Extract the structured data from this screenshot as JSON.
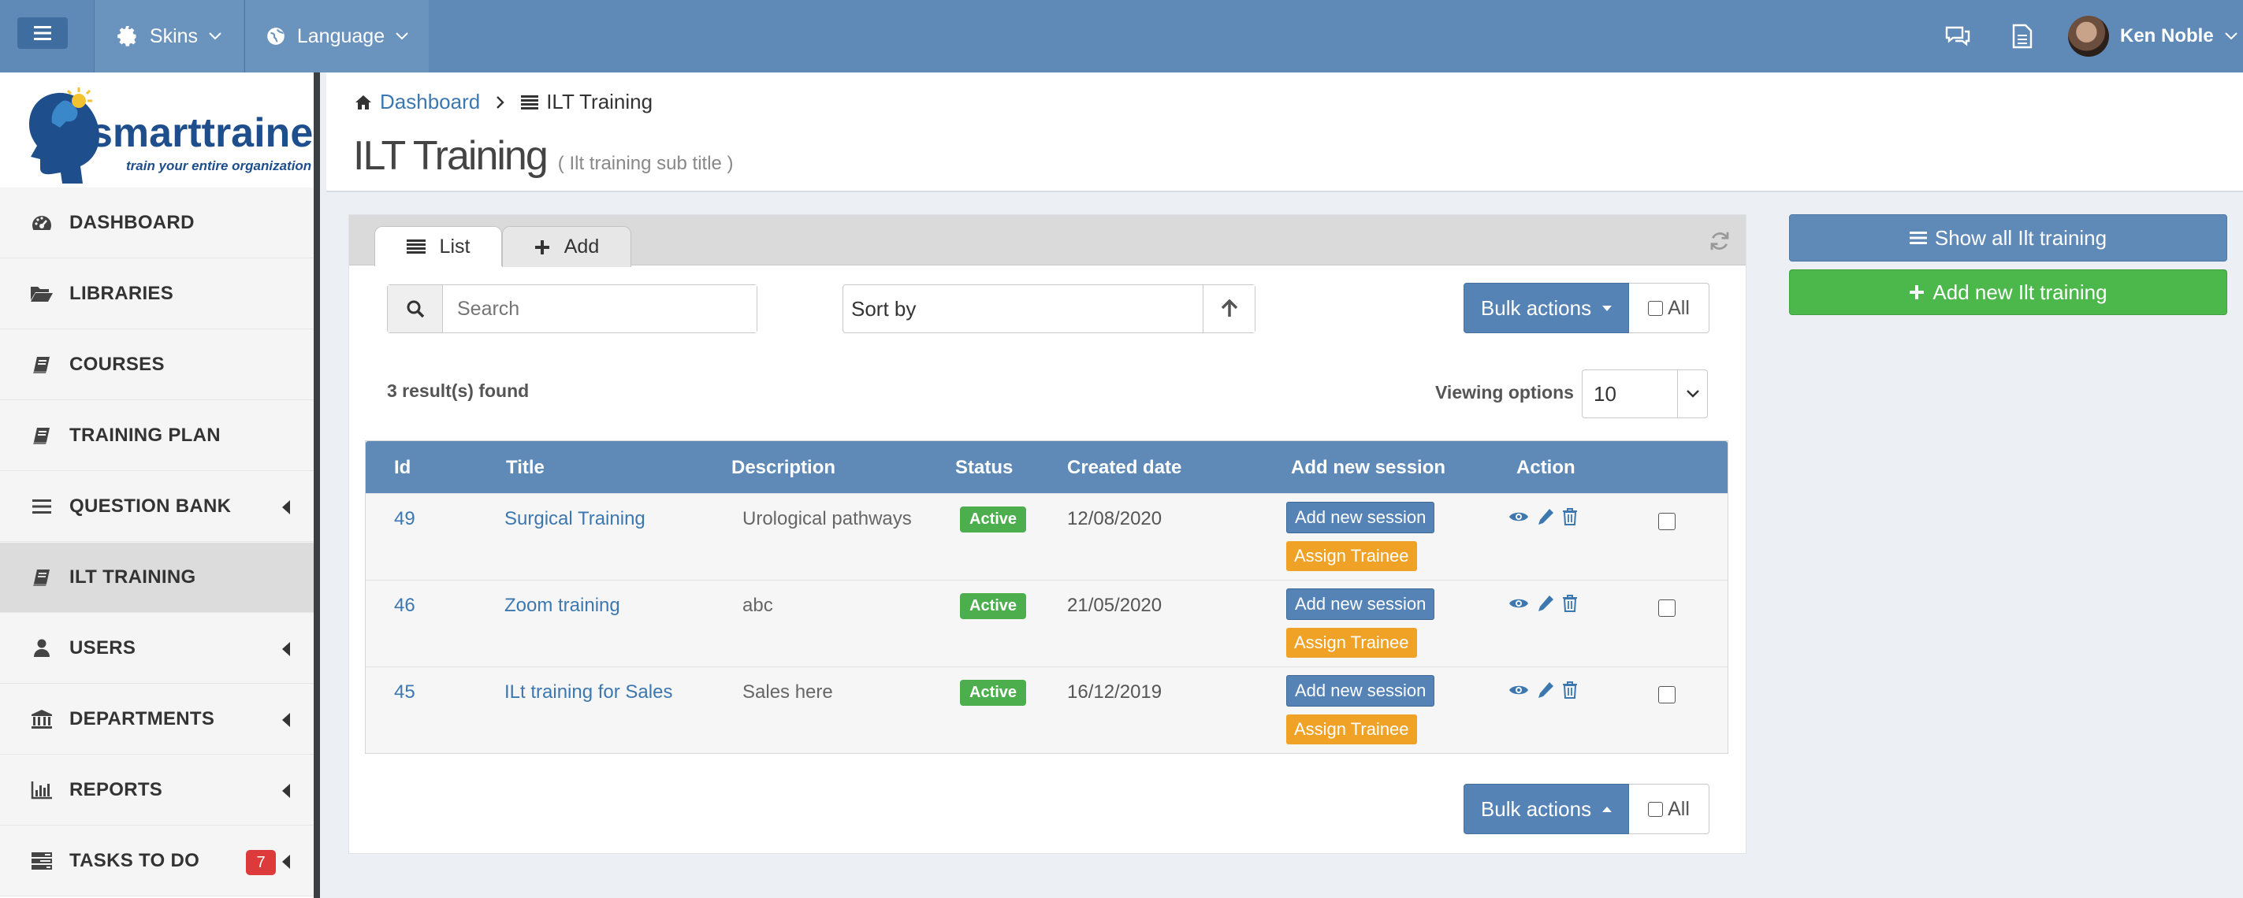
{
  "topbar": {
    "skins_label": "Skins",
    "language_label": "Language",
    "user_name": "Ken Noble"
  },
  "brand": {
    "logo_text": "smarttrainer",
    "tagline": "train your entire organization"
  },
  "sidebar": {
    "items": [
      {
        "label": "DASHBOARD",
        "icon": "dashboard-icon"
      },
      {
        "label": "LIBRARIES",
        "icon": "folder-open-icon"
      },
      {
        "label": "COURSES",
        "icon": "book-icon"
      },
      {
        "label": "TRAINING PLAN",
        "icon": "book-icon"
      },
      {
        "label": "QUESTION BANK",
        "icon": "list-icon"
      },
      {
        "label": "ILT TRAINING",
        "icon": "book-icon"
      },
      {
        "label": "USERS",
        "icon": "user-icon"
      },
      {
        "label": "DEPARTMENTS",
        "icon": "bank-icon"
      },
      {
        "label": "REPORTS",
        "icon": "bar-chart-icon"
      },
      {
        "label": "TASKS TO DO",
        "icon": "tasks-icon",
        "badge": "7"
      }
    ]
  },
  "breadcrumb": {
    "home": "Dashboard",
    "current": "ILT Training"
  },
  "page": {
    "title": "ILT Training",
    "subtitle": "( Ilt training sub title )"
  },
  "tabs": {
    "list": "List",
    "add": "Add"
  },
  "search": {
    "placeholder": "Search"
  },
  "sort": {
    "label": "Sort by"
  },
  "bulk": {
    "label": "Bulk actions",
    "all_label": "All"
  },
  "results": {
    "count_text": "3 result(s) found",
    "viewing_label": "Viewing options",
    "per_page": "10"
  },
  "table": {
    "headers": [
      "Id",
      "Title",
      "Description",
      "Status",
      "Created date",
      "Add new session",
      "Action"
    ],
    "rows": [
      {
        "id": "49",
        "title": "Surgical Training",
        "description": "Urological pathways",
        "status": "Active",
        "created": "12/08/2020",
        "session_btn": "Add new session",
        "assign_btn": "Assign Trainee"
      },
      {
        "id": "46",
        "title": "Zoom training",
        "description": "abc",
        "status": "Active",
        "created": "21/05/2020",
        "session_btn": "Add new session",
        "assign_btn": "Assign Trainee"
      },
      {
        "id": "45",
        "title": "ILt training for Sales",
        "description": "Sales here",
        "status": "Active",
        "created": "16/12/2019",
        "session_btn": "Add new session",
        "assign_btn": "Assign Trainee"
      }
    ]
  },
  "right_panel": {
    "show_all": "Show all Ilt training",
    "add_new": "Add new Ilt training"
  },
  "colors": {
    "primary": "#5f8ab7",
    "success": "#4cb84c",
    "warning": "#f0a227",
    "danger": "#dd3b3b"
  }
}
